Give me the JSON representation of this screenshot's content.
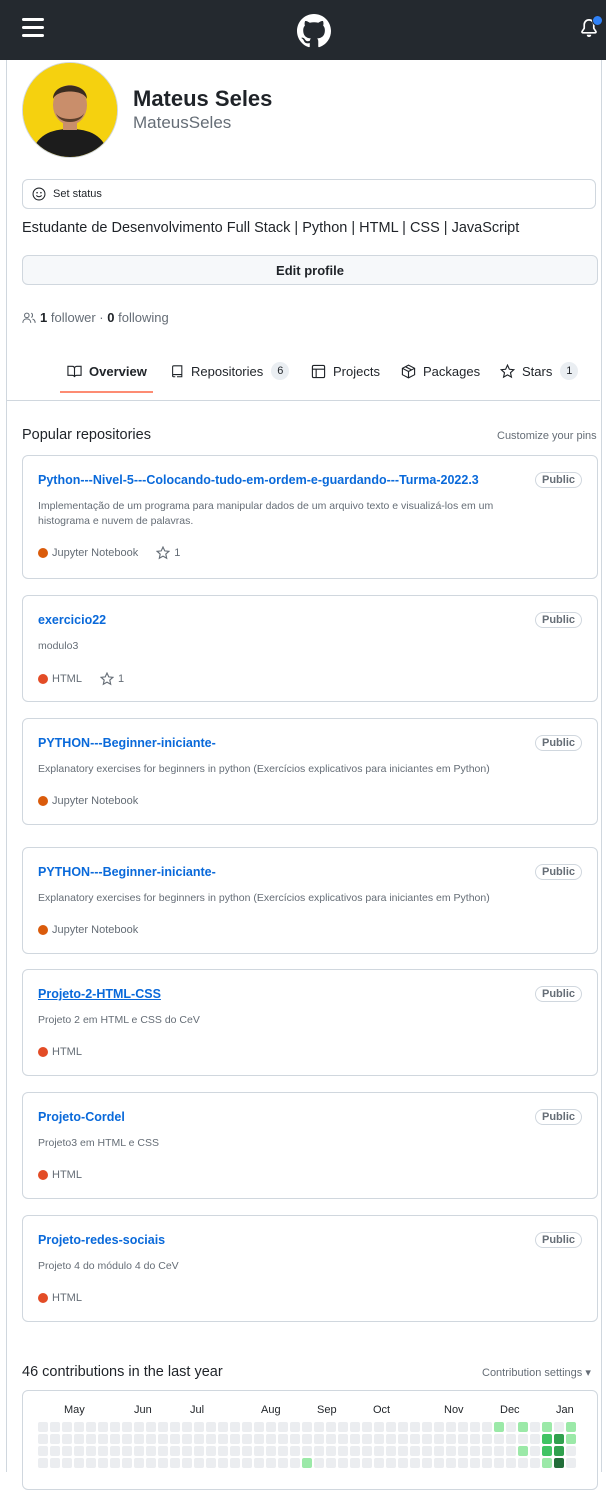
{
  "header": {
    "menu_icon": "hamburger-icon",
    "logo_icon": "github-mark-icon",
    "bell_icon": "bell-icon"
  },
  "profile": {
    "name": "Mateus Seles",
    "login": "MateusSeles",
    "status_label": "Set status",
    "bio": "Estudante de Desenvolvimento Full Stack | Python | HTML | CSS | JavaScript",
    "edit_label": "Edit profile",
    "followers_count": "1",
    "followers_label": "follower",
    "separator": "·",
    "following_count": "0",
    "following_label": "following"
  },
  "tabs": [
    {
      "label": "Overview",
      "icon": "book-icon"
    },
    {
      "label": "Repositories",
      "icon": "repo-icon",
      "count": "6"
    },
    {
      "label": "Projects",
      "icon": "table-icon"
    },
    {
      "label": "Packages",
      "icon": "package-icon"
    },
    {
      "label": "Stars",
      "icon": "star-icon",
      "count": "1"
    }
  ],
  "popular": {
    "title": "Popular repositories",
    "customize": "Customize your pins",
    "repos": [
      {
        "name": "Python---Nivel-5---Colocando-tudo-em-ordem-e-guardando---Turma-2022.3",
        "badge": "Public",
        "desc": "Implementação de um programa para manipular dados de um arquivo texto e visualizá-los em um histograma e nuvem de palavras.",
        "lang": "Jupyter Notebook",
        "stars": "1"
      },
      {
        "name": "exercicio22",
        "badge": "Public",
        "desc": "modulo3",
        "lang": "HTML",
        "stars": "1"
      },
      {
        "name": "PYTHON---Beginner-iniciante-",
        "badge": "Public",
        "desc": "Explanatory exercises for beginners in python (Exercícios explicativos para iniciantes em Python)",
        "lang": "Jupyter Notebook"
      },
      {
        "name": "PYTHON---Beginner-iniciante-",
        "badge": "Public",
        "desc": "Explanatory exercises for beginners in python (Exercícios explicativos para iniciantes em Python)",
        "lang": "Jupyter Notebook"
      },
      {
        "name": "Projeto-2-HTML-CSS",
        "badge": "Public",
        "desc": "Projeto 2 em HTML e CSS do CeV",
        "lang": "HTML"
      },
      {
        "name": "Projeto-Cordel",
        "badge": "Public",
        "desc": "Projeto3 em HTML e CSS",
        "lang": "HTML"
      },
      {
        "name": "Projeto-redes-sociais",
        "badge": "Public",
        "desc": "Projeto 4 do módulo 4 do CeV",
        "lang": "HTML"
      }
    ]
  },
  "contributions": {
    "title": "46 contributions in the last year",
    "settings": "Contribution settings ▾",
    "months": [
      "May",
      "Jun",
      "Jul",
      "Aug",
      "Sep",
      "Oct",
      "Nov",
      "Dec",
      "Jan"
    ]
  },
  "colors": {
    "jupyter": "#DA5B0B",
    "html": "#e34c26",
    "link": "#0969da",
    "tab_underline": "#fd8c73",
    "contrib_levels": [
      "#ebedf0",
      "#9be9a8",
      "#40c463",
      "#30a14e",
      "#216e39"
    ]
  }
}
